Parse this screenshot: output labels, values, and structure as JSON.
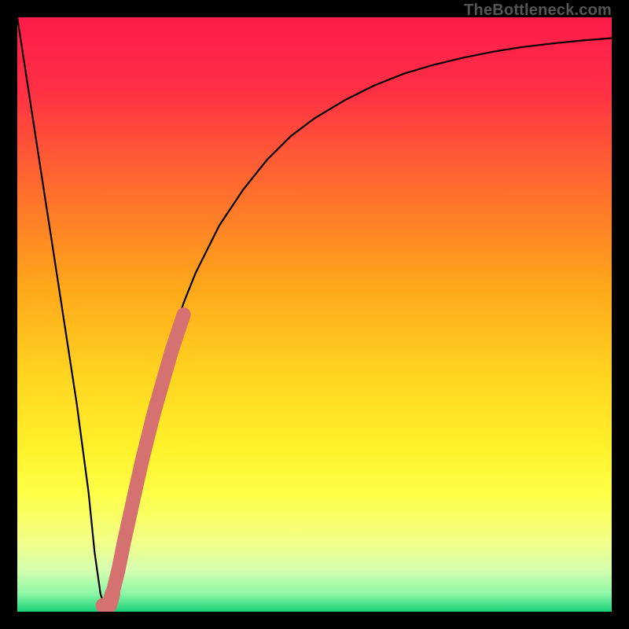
{
  "attribution": "TheBottleneck.com",
  "colors": {
    "frame": "#000000",
    "gradient_stops": [
      {
        "offset": 0.0,
        "color": "#ff1b4b"
      },
      {
        "offset": 0.12,
        "color": "#ff2f45"
      },
      {
        "offset": 0.28,
        "color": "#ff6a2f"
      },
      {
        "offset": 0.45,
        "color": "#ffa61a"
      },
      {
        "offset": 0.6,
        "color": "#ffd420"
      },
      {
        "offset": 0.72,
        "color": "#fff02a"
      },
      {
        "offset": 0.8,
        "color": "#ffff46"
      },
      {
        "offset": 0.88,
        "color": "#f3ff86"
      },
      {
        "offset": 0.93,
        "color": "#d6ffb0"
      },
      {
        "offset": 0.97,
        "color": "#8cf7a7"
      },
      {
        "offset": 1.0,
        "color": "#18d178"
      }
    ],
    "curve": "#000000",
    "marker": "#d57271"
  },
  "chart_data": {
    "type": "line",
    "title": "",
    "xlabel": "",
    "ylabel": "",
    "xlim": [
      0,
      100
    ],
    "ylim": [
      0,
      100
    ],
    "note": "y is bottleneck percentage (0 at valley bottom, 100 at top). x is a normalized hardware-ratio axis. Values estimated from pixel positions; the image has no numeric tick labels.",
    "series": [
      {
        "name": "bottleneck-curve",
        "x": [
          0,
          2,
          4,
          6,
          8,
          10,
          12,
          13,
          14,
          15,
          16,
          18,
          20,
          22,
          24,
          26,
          28,
          30,
          34,
          38,
          42,
          46,
          50,
          55,
          60,
          65,
          70,
          75,
          80,
          85,
          90,
          95,
          100
        ],
        "y": [
          100,
          87,
          74,
          61,
          48,
          35,
          20,
          10,
          3,
          0,
          3,
          12,
          22,
          31,
          39,
          46,
          52,
          57,
          65,
          71,
          76,
          80,
          83,
          86,
          88.5,
          90.5,
          92,
          93.2,
          94.2,
          95,
          95.6,
          96.1,
          96.5
        ]
      },
      {
        "name": "highlight-markers",
        "x": [
          14.5,
          15.0,
          15.5,
          16.0,
          17.0,
          18.0,
          20.0,
          21.0,
          22.0,
          23.0,
          24.0,
          25.0,
          26.0,
          27.0,
          28.0
        ],
        "y": [
          1.0,
          0.5,
          1.2,
          3.0,
          7.0,
          12.0,
          21.0,
          25.5,
          29.5,
          33.5,
          37.0,
          40.5,
          44.0,
          47.0,
          50.0
        ]
      }
    ]
  }
}
